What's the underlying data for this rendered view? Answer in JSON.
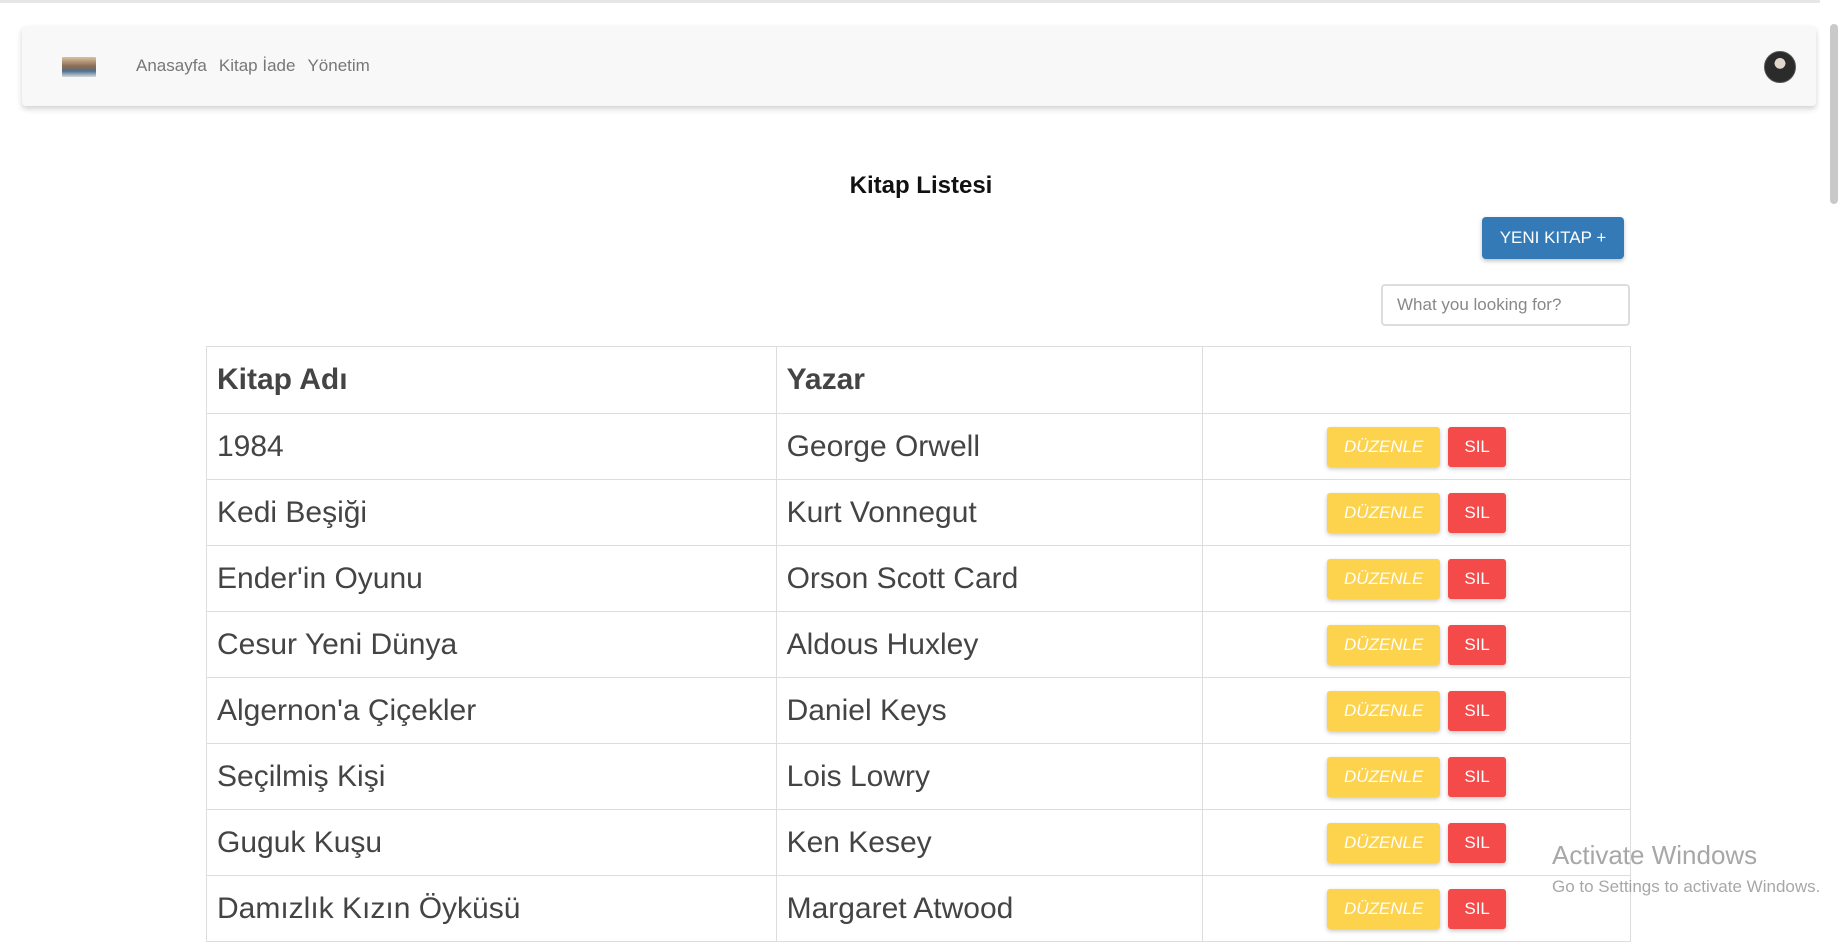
{
  "nav": {
    "links": [
      "Anasayfa",
      "Kitap İade",
      "Yönetim"
    ]
  },
  "page": {
    "title": "Kitap Listesi",
    "new_book_label": "YENI KITAP +",
    "search_placeholder": "What you looking for?"
  },
  "table": {
    "headers": [
      "Kitap Adı",
      "Yazar",
      ""
    ],
    "edit_label": "DÜZENLE",
    "delete_label": "SIL",
    "rows": [
      {
        "title": "1984",
        "author": "George Orwell"
      },
      {
        "title": "Kedi Beşiği",
        "author": "Kurt Vonnegut"
      },
      {
        "title": "Ender'in Oyunu",
        "author": "Orson Scott Card"
      },
      {
        "title": "Cesur Yeni Dünya",
        "author": "Aldous Huxley"
      },
      {
        "title": "Algernon'a Çiçekler",
        "author": "Daniel Keys"
      },
      {
        "title": "Seçilmiş Kişi",
        "author": "Lois Lowry"
      },
      {
        "title": "Guguk Kuşu",
        "author": "Ken Kesey"
      },
      {
        "title": "Damızlık Kızın Öyküsü",
        "author": "Margaret Atwood"
      }
    ]
  },
  "watermark": {
    "title": "Activate Windows",
    "subtitle": "Go to Settings to activate Windows."
  },
  "colors": {
    "primary": "#337ab7",
    "warning": "#fdd24c",
    "danger": "#f44a4a"
  }
}
